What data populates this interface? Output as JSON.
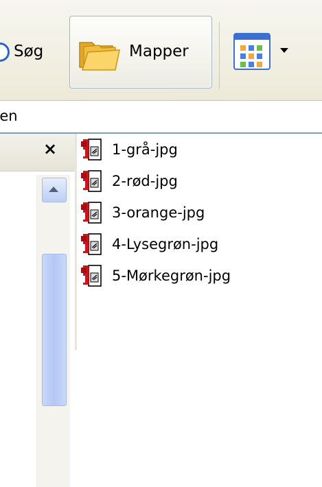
{
  "toolbar": {
    "search_label": "Søg",
    "folders_label": "Mapper",
    "views_icon": "views-icon"
  },
  "address": {
    "label_fragment": "ben"
  },
  "folder_pane": {
    "close_glyph": "×"
  },
  "files": [
    {
      "name": "1-grå-jpg",
      "icon": "file-shortcut-icon"
    },
    {
      "name": "2-rød-jpg",
      "icon": "file-shortcut-icon"
    },
    {
      "name": "3-orange-jpg",
      "icon": "file-shortcut-icon"
    },
    {
      "name": "4-Lysegrøn-jpg",
      "icon": "file-shortcut-icon"
    },
    {
      "name": "5-Mørkegrøn-jpg",
      "icon": "file-shortcut-icon"
    }
  ],
  "colors": {
    "toolbar_bg": "#ece9d8",
    "accent_blue": "#3b6fd0",
    "folder_yellow": "#f3c34a",
    "icon_red": "#c8161d"
  }
}
